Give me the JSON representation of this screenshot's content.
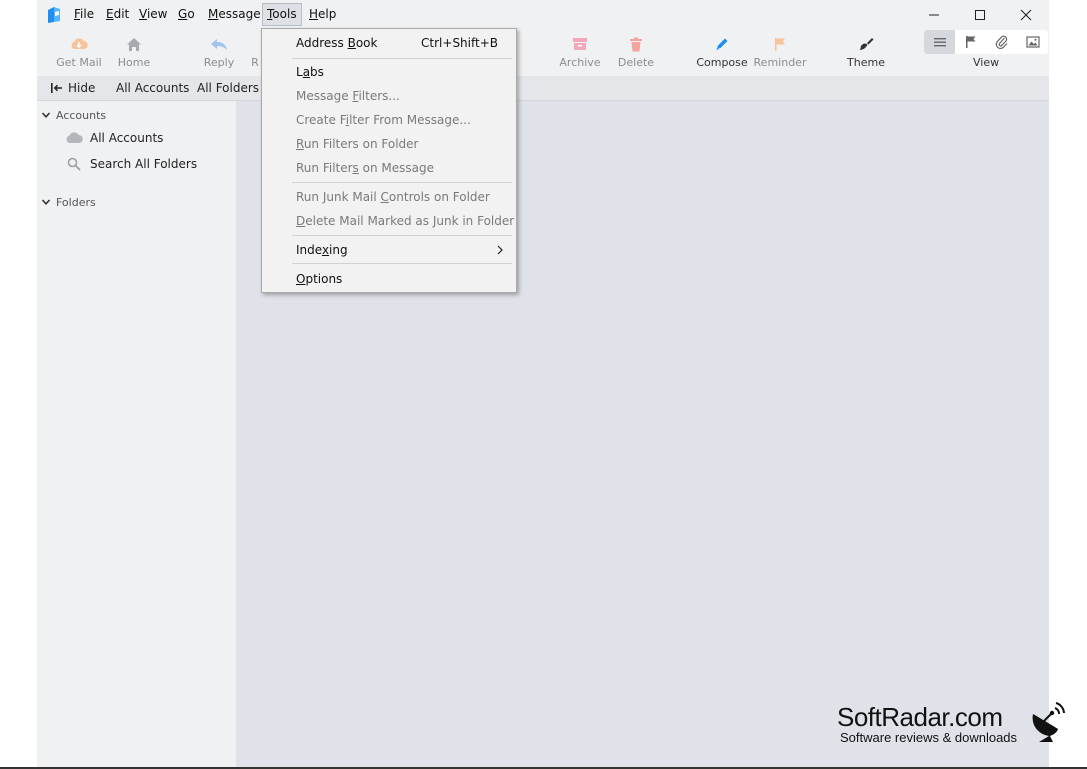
{
  "menubar": {
    "items": [
      {
        "pre": "",
        "key": "F",
        "post": "ile"
      },
      {
        "pre": "",
        "key": "E",
        "post": "dit"
      },
      {
        "pre": "",
        "key": "V",
        "post": "iew"
      },
      {
        "pre": "",
        "key": "G",
        "post": "o"
      },
      {
        "pre": "",
        "key": "M",
        "post": "essage"
      },
      {
        "pre": "",
        "key": "T",
        "post": "ools"
      },
      {
        "pre": "",
        "key": "H",
        "post": "elp"
      }
    ]
  },
  "toolbar": {
    "get_mail": "Get Mail",
    "home": "Home",
    "reply": "Reply",
    "reply_all_partial": "R",
    "archive": "Archive",
    "delete": "Delete",
    "compose": "Compose",
    "reminder": "Reminder",
    "theme": "Theme",
    "view": "View"
  },
  "pane_header": {
    "hide": "Hide",
    "all_accounts": "All Accounts",
    "all_folders": "All Folders"
  },
  "sidebar": {
    "accounts_header": "Accounts",
    "all_accounts": "All Accounts",
    "search_all_folders": "Search All Folders",
    "folders_header": "Folders"
  },
  "tools_menu": {
    "address_book": {
      "pre": "Address ",
      "key": "B",
      "post": "ook",
      "shortcut": "Ctrl+Shift+B"
    },
    "labs": {
      "pre": "L",
      "key": "a",
      "post": "bs"
    },
    "message_filters": {
      "pre": "Message ",
      "key": "F",
      "post": "ilters..."
    },
    "create_filter": {
      "pre": "Create F",
      "key": "i",
      "post": "lter From Message..."
    },
    "run_filters_folder": {
      "pre": "",
      "key": "R",
      "post": "un Filters on Folder"
    },
    "run_filters_message": {
      "pre": "Run Filter",
      "key": "s",
      "post": " on Message"
    },
    "run_junk": {
      "pre": "Run Junk Mail ",
      "key": "C",
      "post": "ontrols on Folder"
    },
    "delete_junk": {
      "pre": "",
      "key": "D",
      "post": "elete Mail Marked as Junk in Folder"
    },
    "indexing": {
      "pre": "Inde",
      "key": "x",
      "post": "ing"
    },
    "options": {
      "pre": "",
      "key": "O",
      "post": "ptions"
    }
  },
  "watermark": {
    "title": "SoftRadar.com",
    "subtitle": "Software reviews & downloads"
  },
  "colors": {
    "accent_blue": "#1e8ff0",
    "disabled_orange": "#f6c49c",
    "disabled_pink": "#f1a9b9",
    "disabled_red": "#f3a49c",
    "disabled_gray": "#a7aab0"
  }
}
